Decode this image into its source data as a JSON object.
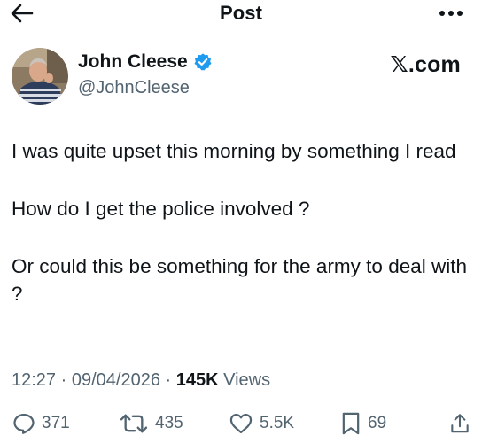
{
  "header": {
    "title": "Post",
    "back_icon": "arrow-left-icon",
    "more_icon": "more-horizontal-icon"
  },
  "author": {
    "name": "John Cleese",
    "handle": "@JohnCleese",
    "verified_icon": "verified-badge-icon",
    "verified_color": "#1d9bf0"
  },
  "brand": {
    "label": "𝕏.com"
  },
  "tweet": {
    "paragraphs": [
      "I was quite upset this morning by something I read",
      "How do I get the police involved ?",
      "Or could this be something for the army to deal with ?"
    ]
  },
  "meta": {
    "time": "12:27",
    "sep1": " · ",
    "date": "09/04/2026",
    "sep2": " · ",
    "views_count": "145K",
    "views_label": " Views"
  },
  "actions": {
    "replies": {
      "icon": "reply-icon",
      "count": "371"
    },
    "reposts": {
      "icon": "repost-icon",
      "count": "435"
    },
    "likes": {
      "icon": "heart-icon",
      "count": "5.5K"
    },
    "bookmarks": {
      "icon": "bookmark-icon",
      "count": "69"
    },
    "share": {
      "icon": "share-icon"
    }
  },
  "colors": {
    "text": "#0f1419",
    "secondary": "#536471",
    "accent": "#1d9bf0"
  }
}
